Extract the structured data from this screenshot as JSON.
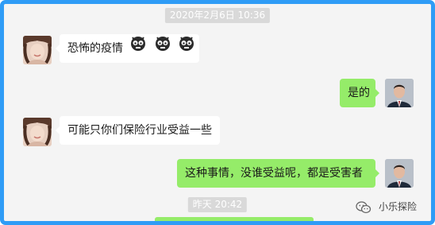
{
  "chat": {
    "timestamps": [
      "2020年2月6日 10:36",
      "昨天 20:42"
    ],
    "messages": [
      {
        "side": "left",
        "text": "恐怖的疫情",
        "emojis": [
          "skull-face-emoji",
          "skull-face-emoji",
          "skull-face-emoji"
        ]
      },
      {
        "side": "right",
        "text": "是的"
      },
      {
        "side": "left",
        "text": "可能只你们保险行业受益一些"
      },
      {
        "side": "right",
        "text": "这种事情，没谁受益呢，都是受害者"
      }
    ]
  },
  "watermark": {
    "text": "小乐探险",
    "icon": "wechat-icon"
  },
  "colors": {
    "border": "#2f9cf6",
    "sent_bubble": "#95ec69",
    "received_bubble": "#ffffff",
    "background": "#f4f4f4",
    "timestamp_bg": "#d9d9d9"
  }
}
